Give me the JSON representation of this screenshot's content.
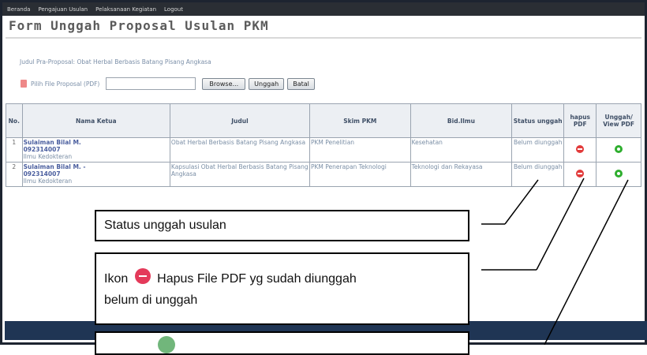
{
  "nav": [
    "Beranda",
    "Pengajuan Usulan",
    "Pelaksanaan Kegiatan",
    "Logout"
  ],
  "title": "Form Unggah Proposal Usulan PKM",
  "judul_pra": "Judul Pra-Proposal: Obat Herbal Berbasis Batang Pisang Angkasa",
  "upload": {
    "label": "Pilih File Proposal (PDF)",
    "browse": "Browse...",
    "unggah": "Unggah",
    "batal": "Batal"
  },
  "table": {
    "headers": [
      "No.",
      "Nama Ketua",
      "Judul",
      "Skim PKM",
      "Bid.Ilmu",
      "Status unggah",
      "hapus PDF",
      "Unggah/ View PDF"
    ],
    "rows": [
      {
        "no": "1",
        "nama": "Sulaiman Bilal M.",
        "nim": "092314007",
        "prodi": "Ilmu Kedokteran",
        "judul": "Obat Herbal Berbasis Batang Pisang Angkasa",
        "skim": "PKM Penelitian",
        "bidang": "Kesehatan",
        "status": "Belum diunggah"
      },
      {
        "no": "2",
        "nama": "Sulaiman Bilal M. -",
        "nim": "092314007",
        "prodi": "Ilmu Kedokteran",
        "judul": "Kapsulasi Obat Herbal Berbasis Batang Pisang Angkasa",
        "skim": "PKM Penerapan Teknologi",
        "bidang": "Teknologi dan Rekayasa",
        "status": "Belum diunggah"
      }
    ]
  },
  "callouts": {
    "status": "Status unggah usulan",
    "hapus_prefix": "Ikon",
    "hapus_text": "Hapus File PDF yg sudah diunggah",
    "hapus_line2": "belum di unggah"
  },
  "icons": {
    "hapus": "minus-circle-icon",
    "unggah": "upload-circle-icon",
    "pdf": "pdf-file-icon"
  },
  "colors": {
    "accent_red": "#e23b3b",
    "accent_green": "#2eae2e",
    "status_orange": "#f08a22",
    "nav_bg": "#2a2e34",
    "footer_bg": "#1f3554"
  }
}
